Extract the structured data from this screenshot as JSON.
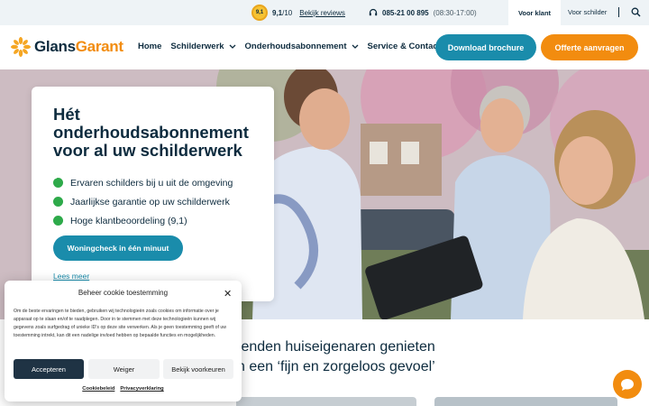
{
  "topbar": {
    "rating_badge": "9,1",
    "rating_score": "9,1",
    "rating_scale": "/10",
    "reviews_link": "Bekijk reviews",
    "phone_number": "085-21 00 895",
    "phone_hours": "(08:30-17:00)",
    "tab_klant": "Voor klant",
    "tab_schilder": "Voor schilder"
  },
  "logo": {
    "part1": "Glans",
    "part2": "Garant"
  },
  "nav": {
    "items": [
      {
        "label": "Home"
      },
      {
        "label": "Schilderwerk"
      },
      {
        "label": "Onderhoudsabonnement"
      },
      {
        "label": "Service & Contact"
      }
    ],
    "brochure_button": "Download brochure",
    "offerte_button": "Offerte aanvragen"
  },
  "hero": {
    "title": "Hét onderhoudsabonnement voor al uw schilderwerk",
    "bullets": [
      "Ervaren schilders bij u uit de omgeving",
      "Jaarlijkse garantie op uw schilderwerk",
      "Hoge klantbeoordeling (9,1)"
    ],
    "cta": "Woningcheck in één minuut",
    "read_more": "Lees meer"
  },
  "tagline": {
    "line1": "tenden huiseigenaren genieten",
    "line2": "n een ‘fijn en zorgeloos gevoel’"
  },
  "cookie": {
    "title": "Beheer cookie toestemming",
    "text": "Om de beste ervaringen te bieden, gebruiken wij technologieën zoals cookies om informatie over je apparaat op te slaan en/of te raadplegen. Door in te stemmen met deze technologieën kunnen wij gegevens zoals surfgedrag of unieke ID's op deze site verwerken. Als je geen toestemming geeft of uw toestemming intrekt, kan dit een nadelige invloed hebben op bepaalde functies en mogelijkheden.",
    "accept": "Accepteren",
    "deny": "Weiger",
    "preferences": "Bekijk voorkeuren",
    "link_cookie": "Cookiebeleid",
    "link_privacy": "Privacyverklaring"
  },
  "colors": {
    "brand_blue": "#1a8cab",
    "brand_orange": "#f28c0f",
    "navy": "#0d2b3e",
    "check_green": "#2eaa4a"
  },
  "icons": [
    "rating-badge-icon",
    "headset-icon",
    "search-icon",
    "logo-flower-icon",
    "chevron-down-icon",
    "check-icon",
    "close-icon",
    "chat-icon"
  ]
}
